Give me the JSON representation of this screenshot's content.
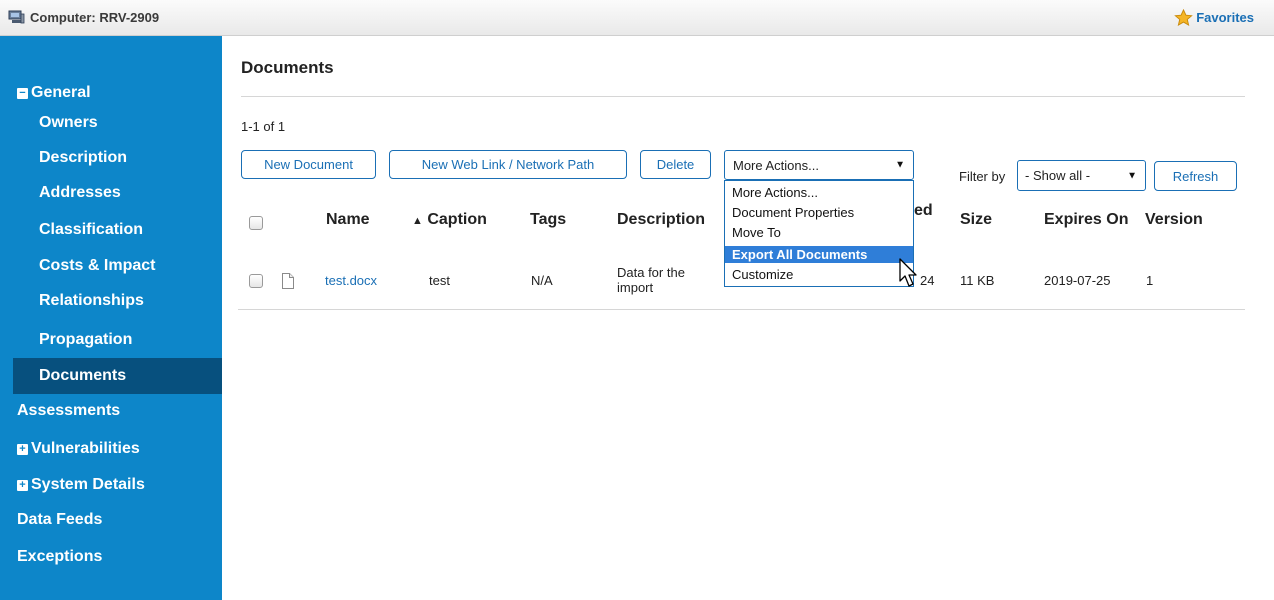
{
  "window": {
    "title": "Computer: RRV-2909",
    "favorites_label": "Favorites"
  },
  "sidebar": {
    "items": [
      {
        "label": "General",
        "toggle": "−"
      },
      {
        "label": "Owners"
      },
      {
        "label": "Description"
      },
      {
        "label": "Addresses"
      },
      {
        "label": "Classification"
      },
      {
        "label": "Costs & Impact"
      },
      {
        "label": "Relationships"
      },
      {
        "label": "Propagation"
      },
      {
        "label": "Documents",
        "active": true
      },
      {
        "label": "Assessments"
      },
      {
        "label": "Vulnerabilities",
        "toggle": "+"
      },
      {
        "label": "System Details",
        "toggle": "+"
      },
      {
        "label": "Data Feeds"
      },
      {
        "label": "Exceptions"
      }
    ]
  },
  "main": {
    "title": "Documents",
    "count": "1-1 of 1",
    "toolbar": {
      "new_document": "New Document",
      "new_web_link": "New Web Link / Network Path",
      "delete": "Delete",
      "more_actions_selected": "More Actions...",
      "more_actions_options": [
        "More Actions...",
        "Document Properties",
        "Move To",
        "Export All Documents",
        "Customize"
      ],
      "highlighted_option": "Export All Documents",
      "filter_label": "Filter by",
      "filter_selected": "- Show all -",
      "refresh": "Refresh"
    },
    "table": {
      "columns": [
        "Name",
        "Caption",
        "Tags",
        "Description",
        "ed",
        "Size",
        "Expires On",
        "Version"
      ],
      "sort_indicator": "▲",
      "rows": [
        {
          "name": "test.docx",
          "caption": "test",
          "tags": "N/A",
          "description_line1": "Data for the",
          "description_line2": "import",
          "date_fragment": "24",
          "size": "11 KB",
          "expires_on": "2019-07-25",
          "version": "1"
        }
      ]
    }
  },
  "colors": {
    "sidebar_bg": "#0d86c9",
    "sidebar_active": "#07507e",
    "accent": "#1a6fb5",
    "highlight": "#2f7ed8"
  },
  "icons": {
    "computer": "computer-icon",
    "favorites": "star-icon",
    "document": "document-icon",
    "cursor": "mouse-cursor-icon"
  }
}
